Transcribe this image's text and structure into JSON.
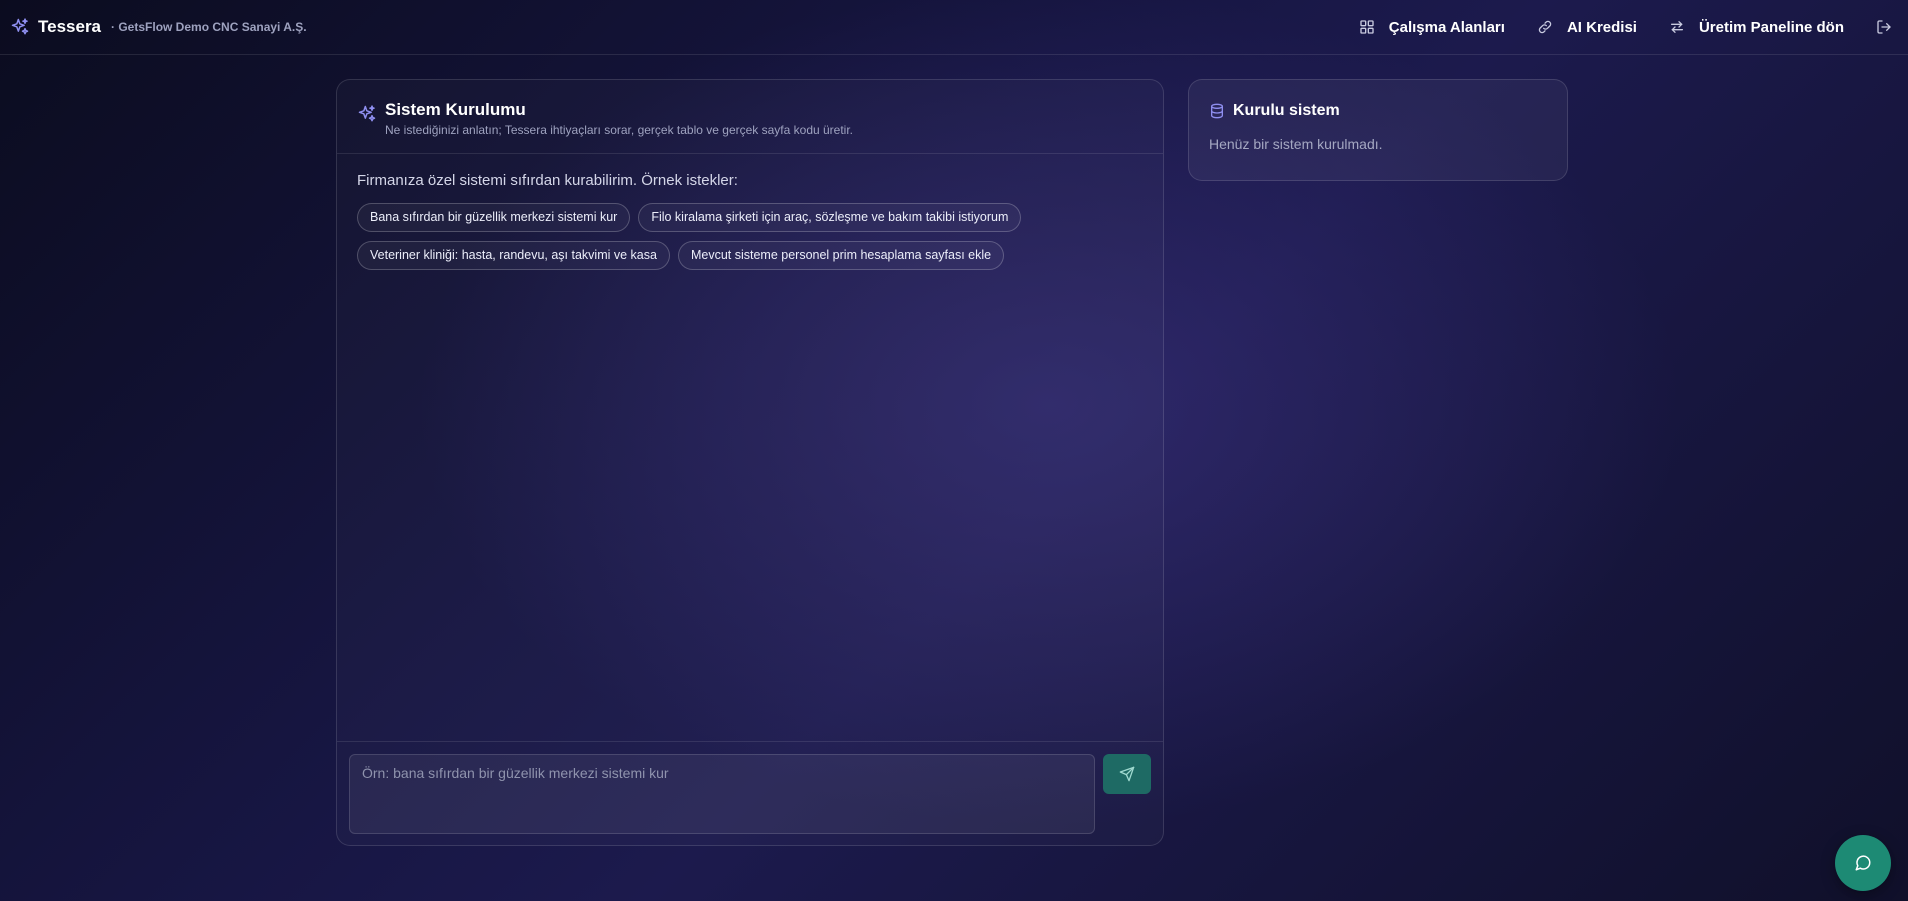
{
  "header": {
    "brand_name": "Tessera",
    "brand_sub": "· GetsFlow Demo CNC Sanayi A.Ş.",
    "nav": [
      {
        "label": "Çalışma Alanları",
        "icon": "grid-icon"
      },
      {
        "label": "AI Kredisi",
        "icon": "link-icon"
      },
      {
        "label": "Üretim Paneline dön",
        "icon": "swap-arrows-icon"
      }
    ],
    "logout_icon": "logout-icon"
  },
  "main": {
    "title": "Sistem Kurulumu",
    "subtitle": "Ne istediğinizi anlatın; Tessera ihtiyaçları sorar, gerçek tablo ve gerçek sayfa kodu üretir.",
    "intro": "Firmanıza özel sistemi sıfırdan kurabilirim. Örnek istekler:",
    "examples": [
      "Bana sıfırdan bir güzellik merkezi sistemi kur",
      "Filo kiralama şirketi için araç, sözleşme ve bakım takibi istiyorum",
      "Veteriner kliniği: hasta, randevu, aşı takvimi ve kasa",
      "Mevcut sisteme personel prim hesaplama sayfası ekle"
    ],
    "composer": {
      "placeholder": "Örn: bana sıfırdan bir güzellik merkezi sistemi kur",
      "value": ""
    }
  },
  "side": {
    "title": "Kurulu sistem",
    "empty": "Henüz bir sistem kurulmadı."
  },
  "colors": {
    "accent_teal": "#1d8a74",
    "send_button": "#1e6a64",
    "icon_violet": "#8f8ff0"
  }
}
